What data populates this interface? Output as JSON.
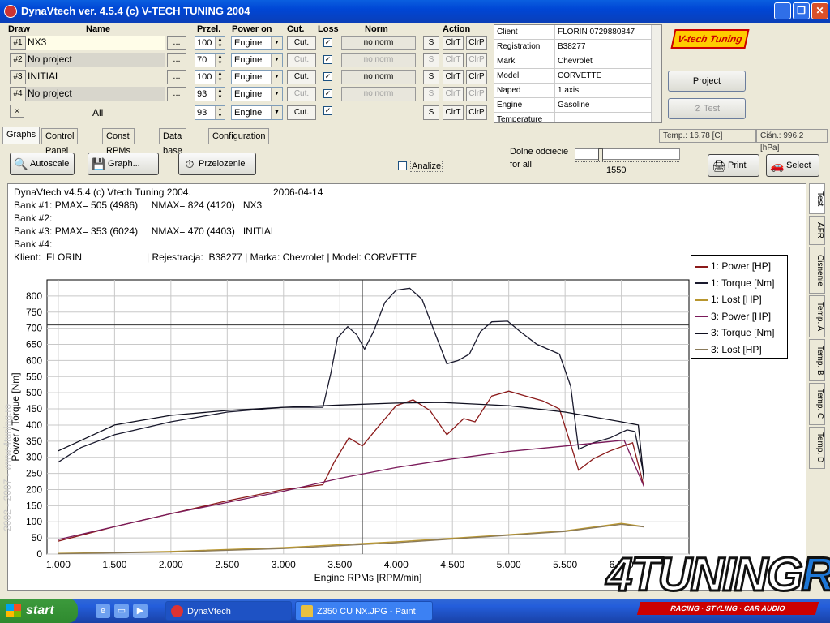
{
  "window": {
    "title": "DynaVtech ver. 4.5.4 (c) V-TECH TUNING 2004",
    "min": "_",
    "max": "❐",
    "close": "✕"
  },
  "headers": {
    "draw": "Draw",
    "name": "Name",
    "przel": "Przel.",
    "power_on": "Power on",
    "cut": "Cut.",
    "loss": "Loss",
    "norm": "Norm",
    "action": "Action"
  },
  "rows": [
    {
      "slot": "#1",
      "name": "NX3",
      "dots": "...",
      "przel": "100",
      "power_on": "Engine",
      "cut": "Cut.",
      "loss": "✓",
      "norm": "no norm",
      "s": "S",
      "clrt": "ClrT",
      "clrp": "ClrP",
      "enabled": true
    },
    {
      "slot": "#2",
      "name": "No project",
      "dots": "...",
      "przel": "70",
      "power_on": "Engine",
      "cut": "Cut.",
      "loss": "✓",
      "norm": "no norm",
      "s": "S",
      "clrt": "ClrT",
      "clrp": "ClrP",
      "enabled": false
    },
    {
      "slot": "#3",
      "name": "INITIAL",
      "dots": "...",
      "przel": "100",
      "power_on": "Engine",
      "cut": "Cut.",
      "loss": "✓",
      "norm": "no norm",
      "s": "S",
      "clrt": "ClrT",
      "clrp": "ClrP",
      "enabled": true
    },
    {
      "slot": "#4",
      "name": "No project",
      "dots": "...",
      "przel": "93",
      "power_on": "Engine",
      "cut": "Cut.",
      "loss": "✓",
      "norm": "no norm",
      "s": "S",
      "clrt": "ClrT",
      "clrp": "ClrP",
      "enabled": false
    }
  ],
  "all_row": {
    "slot": "×",
    "name": "All",
    "przel": "93",
    "power_on": "Engine",
    "cut": "Cut.",
    "loss": "✓",
    "s": "S",
    "clrt": "ClrT",
    "clrp": "ClrP"
  },
  "info": [
    {
      "k": "Client",
      "v": "FLORIN 0729880847"
    },
    {
      "k": "Registration",
      "v": "B38277"
    },
    {
      "k": "Mark",
      "v": "Chevrolet"
    },
    {
      "k": "Model",
      "v": "CORVETTE"
    },
    {
      "k": "Naped",
      "v": "1 axis"
    },
    {
      "k": "Engine",
      "v": "Gasoline"
    },
    {
      "k": "Temperature",
      "v": ""
    }
  ],
  "logo": "V-tech Tuning",
  "project_btn": "Project",
  "test_btn": "Test",
  "tabs": [
    "Graphs",
    "Control Panel",
    "Const RPMs",
    "Data base",
    "Configuration"
  ],
  "status": {
    "temp": "Temp.: 16,78 [C]",
    "press": "Ciśn.: 996,2 [hPa]"
  },
  "toolbar": {
    "autoscale": "Autoscale",
    "graph": "Graph...",
    "przelozenie": "Przelozenie",
    "analize": "Analize",
    "dolne1": "Dolne odciecie",
    "dolne2": "for all",
    "slider_value": "1550",
    "print": "Print",
    "select": "Select"
  },
  "side_tabs": [
    "Test",
    "AFR",
    "Cisnenie",
    "Temp. A",
    "Temp. B",
    "Temp. C",
    "Temp. D"
  ],
  "chart_header": {
    "line1": "DynaVtech v4.5.4 (c) Vtech Tuning 2004.",
    "date": "2006-04-14",
    "bank1": "Bank #1: PMAX= 505 (4986)     NMAX= 824 (4120)   NX3",
    "bank2": "Bank #2:",
    "bank3": "Bank #3: PMAX= 353 (6024)     NMAX= 470 (4403)   INITIAL",
    "bank4": "Bank #4:",
    "klient": "Klient:  FLORIN",
    "rest": "| Rejestracja:  B38277 | Marka: Chevrolet | Model: CORVETTE"
  },
  "watermark": "2002 - 2007 - www.4tuning.ro",
  "chart_data": {
    "type": "line",
    "xlabel": "Engine RPMs [RPM/min]",
    "ylabel": "Power / Torque [Nm]",
    "xlim": [
      900,
      6600
    ],
    "ylim": [
      0,
      850
    ],
    "xticks": [
      1000,
      1500,
      2000,
      2500,
      3000,
      3500,
      4000,
      4500,
      5000,
      5500,
      6000
    ],
    "xtick_labels": [
      "1.000",
      "1.500",
      "2.000",
      "2.500",
      "3.000",
      "3.500",
      "4.000",
      "4.500",
      "5.000",
      "5.500",
      "6.000"
    ],
    "yticks": [
      0,
      50,
      100,
      150,
      200,
      250,
      300,
      350,
      400,
      450,
      500,
      550,
      600,
      650,
      700,
      750,
      800
    ],
    "ref_x": 3700,
    "ref_y": 710,
    "series": [
      {
        "name": "1: Power [HP]",
        "color": "#8b1a1a",
        "x": [
          1000,
          1500,
          2000,
          2500,
          3000,
          3350,
          3450,
          3580,
          3700,
          3830,
          4000,
          4150,
          4300,
          4450,
          4600,
          4700,
          4850,
          5000,
          5150,
          5300,
          5450,
          5550,
          5620,
          5750,
          5900,
          6100,
          6200
        ],
        "y": [
          40,
          85,
          125,
          165,
          200,
          215,
          285,
          360,
          335,
          390,
          460,
          478,
          445,
          370,
          420,
          410,
          490,
          505,
          490,
          475,
          450,
          340,
          260,
          295,
          320,
          345,
          210
        ]
      },
      {
        "name": "1: Torque [Nm]",
        "color": "#1a1a2e",
        "x": [
          1000,
          1200,
          1500,
          2000,
          2500,
          3000,
          3350,
          3420,
          3480,
          3570,
          3650,
          3720,
          3800,
          3900,
          4000,
          4120,
          4230,
          4350,
          4450,
          4550,
          4650,
          4750,
          4850,
          4990,
          5100,
          5250,
          5450,
          5550,
          5620,
          5750,
          5900,
          6050,
          6120,
          6200
        ],
        "y": [
          285,
          330,
          370,
          410,
          440,
          455,
          455,
          560,
          670,
          705,
          680,
          635,
          690,
          780,
          818,
          824,
          790,
          680,
          590,
          600,
          620,
          690,
          720,
          722,
          690,
          650,
          620,
          520,
          325,
          345,
          360,
          385,
          380,
          245
        ]
      },
      {
        "name": "1: Lost [HP]",
        "color": "#b8962e",
        "x": [
          1000,
          2000,
          3000,
          4000,
          5000,
          5500,
          6000,
          6200
        ],
        "y": [
          2,
          8,
          20,
          38,
          60,
          72,
          95,
          85
        ]
      },
      {
        "name": "3: Power [HP]",
        "color": "#7a1a5a",
        "x": [
          1000,
          1500,
          2000,
          2500,
          3000,
          3500,
          4000,
          4500,
          5000,
          5500,
          6024,
          6200
        ],
        "y": [
          45,
          85,
          125,
          160,
          195,
          235,
          268,
          295,
          318,
          335,
          353,
          210
        ]
      },
      {
        "name": "3: Torque [Nm]",
        "color": "#0f0f1f",
        "x": [
          1000,
          1500,
          2000,
          2500,
          3000,
          3500,
          4000,
          4403,
          5000,
          5500,
          6000,
          6150,
          6200
        ],
        "y": [
          320,
          400,
          430,
          445,
          455,
          462,
          468,
          470,
          460,
          440,
          410,
          400,
          230
        ]
      },
      {
        "name": "3: Lost [HP]",
        "color": "#8a7a5a",
        "x": [
          1000,
          2000,
          3000,
          4000,
          5000,
          5500,
          6000,
          6200
        ],
        "y": [
          1,
          6,
          17,
          35,
          58,
          70,
          92,
          84
        ]
      }
    ],
    "legend": "top-right",
    "grid": true
  },
  "taskbar": {
    "start": "start",
    "items": [
      "DynaVtech",
      "Z350 CU NX.JPG - Paint"
    ]
  },
  "brand": {
    "main": "4TUNING",
    "suffix": "RO",
    "sub": "RACING · STYLING · CAR AUDIO"
  }
}
